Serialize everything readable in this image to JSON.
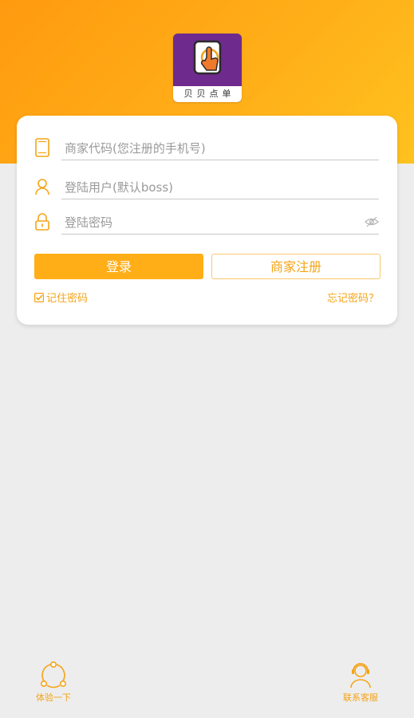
{
  "app": {
    "logo_label": "贝贝点单",
    "colors": {
      "accent": "#FFAE17",
      "header_start": "#FF9A0F",
      "header_end": "#FFC21E",
      "logo_bg": "#6F2A8E",
      "page_bg": "#EDEDED"
    }
  },
  "login_form": {
    "merchant_code": {
      "placeholder": "商家代码(您注册的手机号)",
      "value": "",
      "icon": "phone-icon"
    },
    "username": {
      "placeholder": "登陆用户(默认boss)",
      "value": "",
      "icon": "user-icon"
    },
    "password": {
      "placeholder": "登陆密码",
      "value": "",
      "icon": "lock-icon",
      "toggle_icon": "eye-hidden-icon"
    },
    "login_label": "登录",
    "register_label": "商家注册",
    "remember_label": "记住密码",
    "remember_checked": true,
    "forgot_label": "忘记密码？"
  },
  "bottom_bar": {
    "try_label": "体验一下",
    "try_icon": "share-circle-icon",
    "support_label": "联系客服",
    "support_icon": "headset-icon"
  }
}
